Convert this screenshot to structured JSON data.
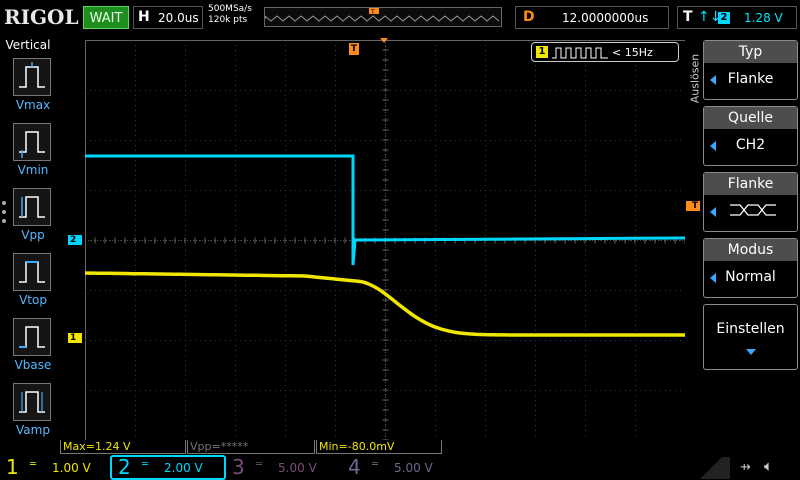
{
  "topbar": {
    "brand": "RIGOL",
    "run_state": "WAIT",
    "horizontal": {
      "letter": "H",
      "timebase": "20.0us"
    },
    "sample_rate": "500MSa/s",
    "memory_depth": "120k pts",
    "delay": {
      "letter": "D",
      "value": "12.0000000us"
    },
    "trigger": {
      "letter": "T",
      "edge_symbol": "↑↓",
      "source": "2",
      "level": "1.28 V"
    }
  },
  "leftpanel": {
    "title": "Vertical",
    "measurements": [
      "Vmax",
      "Vmin",
      "Vpp",
      "Vtop",
      "Vbase",
      "Vamp"
    ]
  },
  "screen": {
    "trigger_marker": "T",
    "ch2_marker": "2",
    "ch1_marker": "1",
    "trigger_level_marker": "T",
    "trigger_source_readout": {
      "channel": "1",
      "frequency": "< 15Hz"
    }
  },
  "rightmenu": {
    "side_label": "Auslösen",
    "items": [
      {
        "head": "Typ",
        "value": "Flanke"
      },
      {
        "head": "Quelle",
        "value": "CH2"
      },
      {
        "head": "Flanke",
        "value": ""
      },
      {
        "head": "Modus",
        "value": "Normal"
      }
    ],
    "button": "Einstellen"
  },
  "measure_results": {
    "m1": "Max=1.24 V",
    "m2": "Vpp=*****",
    "m3": "Min=-80.0mV"
  },
  "bottombar": {
    "channels": [
      {
        "num": "1",
        "coupling": "═",
        "scale": "1.00 V"
      },
      {
        "num": "2",
        "coupling": "═",
        "scale": "2.00 V"
      },
      {
        "num": "3",
        "coupling": "═",
        "scale": "5.00 V"
      },
      {
        "num": "4",
        "coupling": "═",
        "scale": "5.00 V"
      }
    ]
  },
  "colors": {
    "ch1": "#f0e600",
    "ch2": "#00d7ff",
    "trigger": "#ff8c1a",
    "menu_accent": "#3aa9ff"
  }
}
